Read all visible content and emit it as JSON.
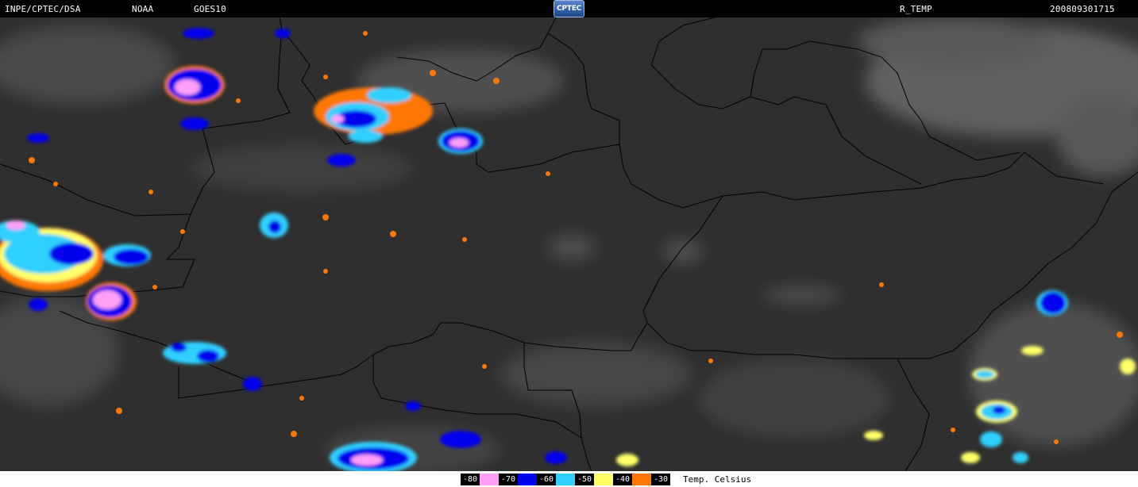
{
  "header": {
    "source": "INPE/CPTEC/DSA",
    "agency": "NOAA",
    "satellite": "GOES10",
    "logo": "CPTEC",
    "product": "R_TEMP",
    "datetime": "200809301715"
  },
  "legend": {
    "unit": "Temp. Celsius",
    "items": [
      {
        "label": "-80",
        "color": "#ff9ff5"
      },
      {
        "label": "-70",
        "color": "#0000ee"
      },
      {
        "label": "-60",
        "color": "#2ed0ff"
      },
      {
        "label": "-50",
        "color": "#ffff66"
      },
      {
        "label": "-40",
        "color": "#ff7700"
      },
      {
        "label": "-30",
        "color": ""
      }
    ]
  },
  "colors": {
    "background_ir": "#2e2e2e",
    "cloud_gray": "#9a9a9a",
    "borders": "#000000"
  }
}
